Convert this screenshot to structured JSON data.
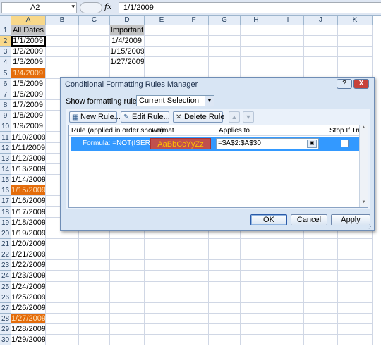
{
  "formula_bar": {
    "name_box": "A2",
    "fx_label": "fx",
    "formula": "1/1/2009"
  },
  "sheet": {
    "columns": [
      "A",
      "B",
      "C",
      "D",
      "E",
      "F",
      "G",
      "H",
      "I",
      "J",
      "K"
    ],
    "selected_column": "A",
    "selected_row": 2,
    "rows": [
      {
        "n": "1",
        "a": "All Dates",
        "d": "Important"
      },
      {
        "n": "2",
        "a": "1/1/2009",
        "d": "1/4/2009"
      },
      {
        "n": "3",
        "a": "1/2/2009",
        "d": "1/15/2009"
      },
      {
        "n": "4",
        "a": "1/3/2009",
        "d": "1/27/2009"
      },
      {
        "n": "5",
        "a": "1/4/2009",
        "d": ""
      },
      {
        "n": "6",
        "a": "1/5/2009",
        "d": ""
      },
      {
        "n": "7",
        "a": "1/6/2009",
        "d": ""
      },
      {
        "n": "8",
        "a": "1/7/2009",
        "d": ""
      },
      {
        "n": "9",
        "a": "1/8/2009",
        "d": ""
      },
      {
        "n": "10",
        "a": "1/9/2009",
        "d": ""
      },
      {
        "n": "11",
        "a": "1/10/2009",
        "d": ""
      },
      {
        "n": "12",
        "a": "1/11/2009",
        "d": ""
      },
      {
        "n": "13",
        "a": "1/12/2009",
        "d": ""
      },
      {
        "n": "14",
        "a": "1/13/2009",
        "d": ""
      },
      {
        "n": "15",
        "a": "1/14/2009",
        "d": ""
      },
      {
        "n": "16",
        "a": "1/15/2009",
        "d": ""
      },
      {
        "n": "17",
        "a": "1/16/2009",
        "d": ""
      },
      {
        "n": "18",
        "a": "1/17/2009",
        "d": ""
      },
      {
        "n": "19",
        "a": "1/18/2009",
        "d": ""
      },
      {
        "n": "20",
        "a": "1/19/2009",
        "d": ""
      },
      {
        "n": "21",
        "a": "1/20/2009",
        "d": ""
      },
      {
        "n": "22",
        "a": "1/21/2009",
        "d": ""
      },
      {
        "n": "23",
        "a": "1/22/2009",
        "d": ""
      },
      {
        "n": "24",
        "a": "1/23/2009",
        "d": ""
      },
      {
        "n": "25",
        "a": "1/24/2009",
        "d": ""
      },
      {
        "n": "26",
        "a": "1/25/2009",
        "d": ""
      },
      {
        "n": "27",
        "a": "1/26/2009",
        "d": ""
      },
      {
        "n": "28",
        "a": "1/27/2009",
        "d": ""
      },
      {
        "n": "29",
        "a": "1/28/2009",
        "d": ""
      },
      {
        "n": "30",
        "a": "1/29/2009",
        "d": ""
      }
    ],
    "highlighted_rows": [
      "5",
      "16",
      "28"
    ],
    "highlight_color": "#e46c0a"
  },
  "dialog": {
    "title": "Conditional Formatting Rules Manager",
    "help_label": "?",
    "close_label": "X",
    "show_rules_label": "Show formatting rules for:",
    "show_rules_value": "Current Selection",
    "new_rule": "New Rule...",
    "edit_rule": "Edit Rule...",
    "delete_rule": "Delete Rule",
    "move_up_icon": "arrow-up-icon",
    "move_down_icon": "arrow-down-icon",
    "columns": {
      "rule": "Rule (applied in order shown)",
      "format": "Format",
      "applies_to": "Applies to",
      "stop_if_true": "Stop If True"
    },
    "rules": [
      {
        "rule": "Formula: =NOT(ISERR...",
        "format_preview": "AaBbCcYyZz",
        "applies_to": "=$A$2:$A$30",
        "stop_if_true": false
      }
    ],
    "ok": "OK",
    "cancel": "Cancel",
    "apply": "Apply",
    "selection_color": "#3399ff"
  }
}
